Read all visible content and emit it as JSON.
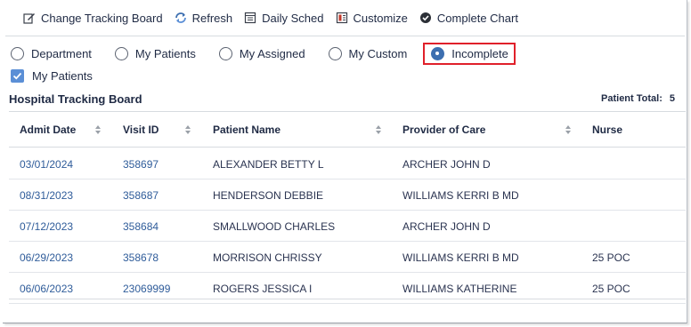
{
  "toolbar": {
    "items": [
      {
        "label": "Change Tracking Board",
        "icon": "pencil-edit-icon"
      },
      {
        "label": "Refresh",
        "icon": "refresh-icon"
      },
      {
        "label": "Daily Sched",
        "icon": "calendar-icon"
      },
      {
        "label": "Customize",
        "icon": "customize-icon"
      },
      {
        "label": "Complete Chart",
        "icon": "check-circle-icon"
      }
    ]
  },
  "filters": {
    "options": [
      "Department",
      "My Patients",
      "My Assigned",
      "My Custom",
      "Incomplete"
    ],
    "selected": "Incomplete"
  },
  "my_patients_checkbox": {
    "label": "My Patients",
    "checked": true
  },
  "board": {
    "title": "Hospital Tracking Board",
    "total_label": "Patient Total:",
    "total_value": "5"
  },
  "table": {
    "columns": [
      "Admit Date",
      "Visit ID",
      "Patient Name",
      "Provider of Care",
      "Nurse"
    ],
    "rows": [
      [
        "03/01/2024",
        "358697",
        "ALEXANDER BETTY L",
        "ARCHER JOHN D",
        ""
      ],
      [
        "08/31/2023",
        "358687",
        "HENDERSON DEBBIE",
        "WILLIAMS KERRI B MD",
        ""
      ],
      [
        "07/12/2023",
        "358684",
        "SMALLWOOD CHARLES",
        "ARCHER JOHN D",
        ""
      ],
      [
        "06/29/2023",
        "358678",
        "MORRISON CHRISSY",
        "WILLIAMS KERRI B MD",
        "25 POC"
      ],
      [
        "06/06/2023",
        "23069999",
        "ROGERS JESSICA I",
        "WILLIAMS KATHERINE",
        "25 POC"
      ]
    ]
  },
  "colors": {
    "highlight": "#e0202a",
    "accent": "#3d6fb0",
    "text": "#1f2a44"
  }
}
